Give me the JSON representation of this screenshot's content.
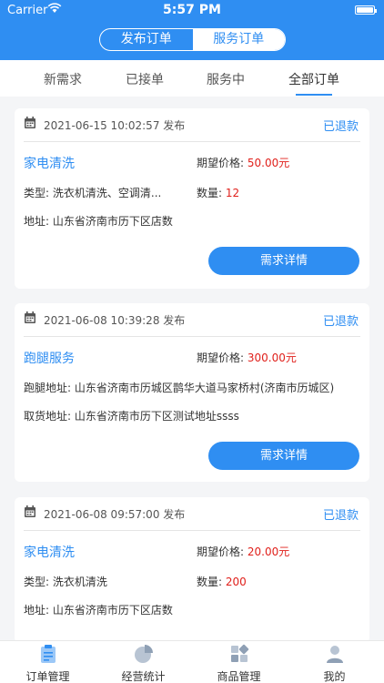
{
  "statusbar": {
    "carrier": "Carrier",
    "time": "5:57 PM"
  },
  "segment": {
    "left": "发布订单",
    "right": "服务订单",
    "active": "right"
  },
  "tabs": [
    {
      "label": "新需求"
    },
    {
      "label": "已接单"
    },
    {
      "label": "服务中"
    },
    {
      "label": "全部订单"
    }
  ],
  "orders": [
    {
      "time": "2021-06-15 10:02:57 发布",
      "status": "已退款",
      "service": "家电清洗",
      "price_label": "期望价格:",
      "price": "50.00元",
      "type_label": "类型:",
      "type": "洗衣机清洗、空调清...",
      "qty_label": "数量:",
      "qty": "12",
      "addr_label": "地址:",
      "addr": "山东省济南市历下区店数",
      "button": "需求详情"
    },
    {
      "time": "2021-06-08 10:39:28 发布",
      "status": "已退款",
      "service": "跑腿服务",
      "price_label": "期望价格:",
      "price": "300.00元",
      "run_label": "跑腿地址:",
      "run_addr": "山东省济南市历城区鹊华大道马家桥村(济南市历城区)",
      "pick_label": "取货地址:",
      "pick_addr": "山东省济南市历下区测试地址ssss",
      "button": "需求详情"
    },
    {
      "time": "2021-06-08 09:57:00 发布",
      "status": "已退款",
      "service": "家电清洗",
      "price_label": "期望价格:",
      "price": "20.00元",
      "type_label": "类型:",
      "type": "洗衣机清洗",
      "qty_label": "数量:",
      "qty": "200",
      "addr_label": "地址:",
      "addr": "山东省济南市历下区店数"
    }
  ],
  "bottom_nav": [
    {
      "label": "订单管理",
      "icon": "clipboard-icon"
    },
    {
      "label": "经营统计",
      "icon": "pie-chart-icon"
    },
    {
      "label": "商品管理",
      "icon": "grid-icon"
    },
    {
      "label": "我的",
      "icon": "user-icon"
    }
  ],
  "colors": {
    "primary": "#2f8ef2",
    "price": "#e0201b",
    "background": "#f4f5f7"
  }
}
